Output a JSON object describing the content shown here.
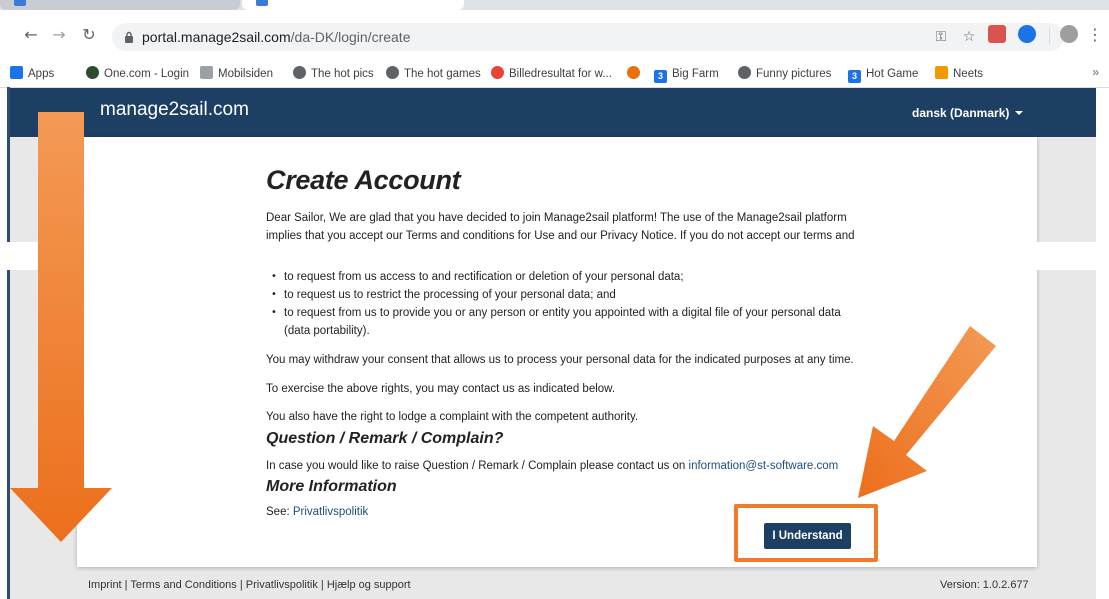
{
  "browser": {
    "url_host": "portal.manage2sail.com",
    "url_path": "/da-DK/login/create",
    "bookmarks": [
      {
        "label": "Apps",
        "icon": "apps-grid-icon"
      },
      {
        "label": "One.com - Login",
        "icon": "onecom-icon"
      },
      {
        "label": "Mobilsiden",
        "icon": "mobilsiden-icon"
      },
      {
        "label": "The hot pics",
        "icon": "globe-icon"
      },
      {
        "label": "The hot games",
        "icon": "globe-icon"
      },
      {
        "label": "Billedresultat for w...",
        "icon": "google-icon"
      },
      {
        "label": "",
        "icon": "circle-icon"
      },
      {
        "label": "Big Farm",
        "icon": "bigfarm-icon"
      },
      {
        "label": "Funny pictures",
        "icon": "globe-icon"
      },
      {
        "label": "Hot Game",
        "icon": "bigfarm-icon"
      },
      {
        "label": "Neets",
        "icon": "neets-icon"
      }
    ],
    "more": "»"
  },
  "site": {
    "logo": "manage2sail.com",
    "language": "dansk (Danmark)"
  },
  "page": {
    "title": "Create Account",
    "intro_line1": "Dear Sailor, We are glad that you have decided to join Manage2sail platform! The use of the Manage2sail platform",
    "intro_line2": "implies that you accept our Terms and conditions for Use and our Privacy Notice. If you do not accept our terms and",
    "rights": [
      "to request from us access to and rectification or deletion of your personal data;",
      "to request us to restrict the processing of your personal data; and",
      "to request from us to provide you or any person or entity you appointed with a digital file of your personal data (data portability)."
    ],
    "withdraw": "You may withdraw your consent that allows us to process your personal data for the indicated purposes at any time.",
    "exercise": "To exercise the above rights, you may contact us as indicated below.",
    "complaint": "You also have the right to lodge a complaint with the competent authority.",
    "question_heading": "Question / Remark / Complain?",
    "contact_prefix": "In case you would like to raise Question / Remark / Complain please contact us on ",
    "contact_email": "information@st-software.com",
    "more_heading": "More Information",
    "see_prefix": "See: ",
    "see_link": "Privatlivspolitik",
    "button": "I Understand"
  },
  "footer": {
    "links": "Imprint | Terms and Conditions | Privatlivspolitik | Hjælp og support",
    "version": "Version: 1.0.2.677"
  },
  "colors": {
    "header": "#1d3f64",
    "arrow": "#f07c2b",
    "link": "#1a4f80"
  }
}
